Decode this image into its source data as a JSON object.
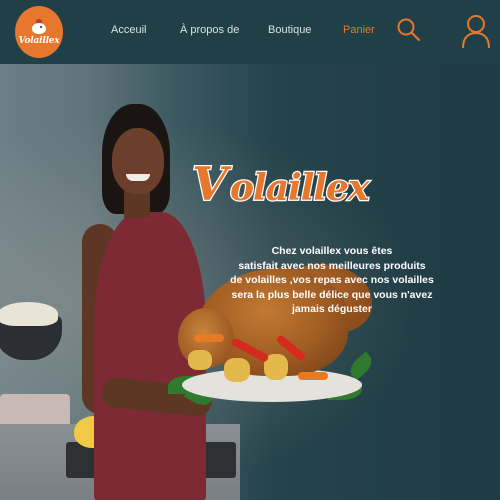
{
  "logo": {
    "text": "Volaillex",
    "icon": "chicken-icon",
    "color": "#e8772e"
  },
  "nav": {
    "items": [
      {
        "label": "Acceuil",
        "active": false
      },
      {
        "label": "À propos de",
        "active": false
      },
      {
        "label": "Boutique",
        "active": false
      },
      {
        "label": "Panier",
        "active": true
      }
    ],
    "search_icon": "search-icon",
    "user_icon": "user-icon"
  },
  "hero": {
    "brand": "Volaillex",
    "tagline_lines": [
      "Chez volaillex vous êtes",
      "satisfait avec nos meilleures produits",
      "de volailles ,vos repas avec nos volailles",
      "sera la plus belle délice que vous n'avez",
      "jamais déguster"
    ]
  },
  "colors": {
    "accent": "#e8772e",
    "navbar": "#203f47",
    "nav_text": "#d9e3e5",
    "brand_fill": "#e8772e",
    "brand_stroke": "#ffffff"
  }
}
